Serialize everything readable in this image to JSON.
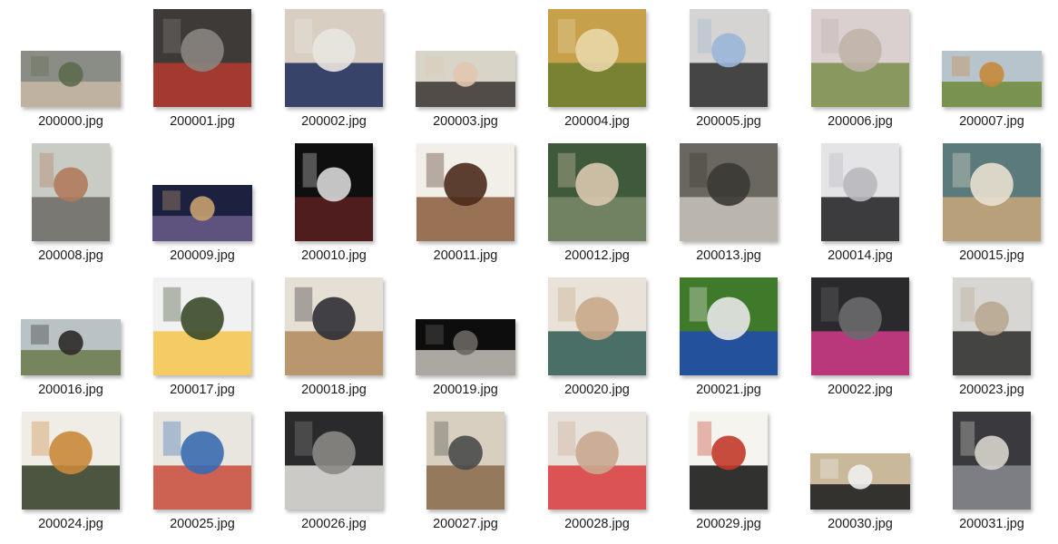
{
  "files": [
    {
      "name": "200000.jpg",
      "icon": "trail-runner-photo-thumbnail",
      "orientation": "landscape",
      "colors": [
        "#8a8d86",
        "#c9b9a4",
        "#5d6a4e"
      ]
    },
    {
      "name": "200001.jpg",
      "icon": "gym-rack-photo-thumbnail",
      "orientation": "square",
      "colors": [
        "#3d3a38",
        "#b53a2e",
        "#8a8580"
      ]
    },
    {
      "name": "200002.jpg",
      "icon": "cap-selfie-photo-thumbnail",
      "orientation": "square",
      "colors": [
        "#d8cfc2",
        "#1c2a5a",
        "#e9e6e1"
      ]
    },
    {
      "name": "200003.jpg",
      "icon": "cyclist-selfie-photo-thumbnail",
      "orientation": "landscape",
      "colors": [
        "#d8d5c8",
        "#3a3430",
        "#e2c7b0"
      ]
    },
    {
      "name": "200004.jpg",
      "icon": "forest-runner-photo-thumbnail",
      "orientation": "square",
      "colors": [
        "#c7a04a",
        "#6a7c2e",
        "#e8d7a8"
      ]
    },
    {
      "name": "200005.jpg",
      "icon": "locker-mirror-photo-thumbnail",
      "orientation": "portrait",
      "colors": [
        "#d6d4d2",
        "#2b2b2d",
        "#9bb6d8"
      ]
    },
    {
      "name": "200006.jpg",
      "icon": "cherry-blossom-path-photo-thumbnail",
      "orientation": "square",
      "colors": [
        "#d9d0cf",
        "#7a8e4a",
        "#bfb3a8"
      ]
    },
    {
      "name": "200007.jpg",
      "icon": "autumn-park-photo-thumbnail",
      "orientation": "landscape",
      "colors": [
        "#b8c4cc",
        "#6e8a3a",
        "#c58a3a"
      ]
    },
    {
      "name": "200008.jpg",
      "icon": "shower-mirror-photo-thumbnail",
      "orientation": "portrait",
      "colors": [
        "#c9cbc5",
        "#6c6a64",
        "#b07a5c"
      ]
    },
    {
      "name": "200009.jpg",
      "icon": "night-crowd-photo-thumbnail",
      "orientation": "landscape",
      "colors": [
        "#1c2140",
        "#6a5a8a",
        "#c9a070"
      ]
    },
    {
      "name": "200010.jpg",
      "icon": "phone-screenshot-thumbnail",
      "orientation": "portrait",
      "colors": [
        "#0f0f10",
        "#5a2020",
        "#d8d8d8"
      ]
    },
    {
      "name": "200011.jpg",
      "icon": "chocolate-plate-photo-thumbnail",
      "orientation": "square",
      "colors": [
        "#f2efe9",
        "#8a5a3a",
        "#4a2a1c"
      ]
    },
    {
      "name": "200012.jpg",
      "icon": "hand-bottle-photo-thumbnail",
      "orientation": "square",
      "colors": [
        "#3f5a3a",
        "#7a8a6a",
        "#d9c8b0"
      ]
    },
    {
      "name": "200013.jpg",
      "icon": "gym-pushups-photo-thumbnail",
      "orientation": "square",
      "colors": [
        "#6a6660",
        "#c8c4bc",
        "#3a3834"
      ]
    },
    {
      "name": "200014.jpg",
      "icon": "couple-studio-photo-thumbnail",
      "orientation": "portrait",
      "colors": [
        "#e4e4e6",
        "#1e1e20",
        "#b8b8bc"
      ]
    },
    {
      "name": "200015.jpg",
      "icon": "cafe-interior-photo-thumbnail",
      "orientation": "square",
      "colors": [
        "#5a7a7c",
        "#c9a87a",
        "#e8e0d0"
      ]
    },
    {
      "name": "200016.jpg",
      "icon": "lake-hiker-photo-thumbnail",
      "orientation": "landscape",
      "colors": [
        "#b9c3c6",
        "#6a7a4a",
        "#2e2a28"
      ]
    },
    {
      "name": "200017.jpg",
      "icon": "egg-bowl-photo-thumbnail",
      "orientation": "square",
      "colors": [
        "#f1f1f1",
        "#f6c64a",
        "#3a4a2a"
      ]
    },
    {
      "name": "200018.jpg",
      "icon": "study-room-photo-thumbnail",
      "orientation": "square",
      "colors": [
        "#e6dfd4",
        "#b08a5a",
        "#2f2f35"
      ]
    },
    {
      "name": "200019.jpg",
      "icon": "deadlift-video-thumbnail",
      "orientation": "landscape",
      "colors": [
        "#0d0d0d",
        "#c8c4bc",
        "#6a6660"
      ]
    },
    {
      "name": "200020.jpg",
      "icon": "living-room-photo-thumbnail",
      "orientation": "square",
      "colors": [
        "#e8e2d8",
        "#2e5a52",
        "#c9a88a"
      ]
    },
    {
      "name": "200021.jpg",
      "icon": "soccer-player-photo-thumbnail",
      "orientation": "square",
      "colors": [
        "#3f7a2a",
        "#1f4ab0",
        "#e8e8e8"
      ]
    },
    {
      "name": "200022.jpg",
      "icon": "car-dashboard-photo-thumbnail",
      "orientation": "square",
      "colors": [
        "#2a2a2c",
        "#d23a8a",
        "#6a6a6e"
      ]
    },
    {
      "name": "200023.jpg",
      "icon": "lobby-mirror-photo-thumbnail",
      "orientation": "portrait",
      "colors": [
        "#d8d6d2",
        "#2a2a2a",
        "#b8a890"
      ]
    },
    {
      "name": "200024.jpg",
      "icon": "meal-tray-photo-thumbnail",
      "orientation": "square",
      "colors": [
        "#f0ede6",
        "#2e3a22",
        "#c9883a"
      ]
    },
    {
      "name": "200025.jpg",
      "icon": "climbing-wall-photo-thumbnail",
      "orientation": "square",
      "colors": [
        "#e9e6e0",
        "#c84a3a",
        "#3a6ab0"
      ]
    },
    {
      "name": "200026.jpg",
      "icon": "bench-press-photo-thumbnail",
      "orientation": "square",
      "colors": [
        "#2a2a2c",
        "#e8e6e2",
        "#8a8884"
      ]
    },
    {
      "name": "200027.jpg",
      "icon": "garage-gym-photo-thumbnail",
      "orientation": "portrait",
      "colors": [
        "#d8cfc0",
        "#8a6a4a",
        "#4a4a4a"
      ]
    },
    {
      "name": "200028.jpg",
      "icon": "baby-highchair-photo-thumbnail",
      "orientation": "square",
      "colors": [
        "#e8e2dc",
        "#d83a3a",
        "#c9a890"
      ]
    },
    {
      "name": "200029.jpg",
      "icon": "calligraphy-photo-thumbnail",
      "orientation": "portrait",
      "colors": [
        "#f6f4ef",
        "#0e0e0e",
        "#c23a2a"
      ]
    },
    {
      "name": "200030.jpg",
      "icon": "black-bags-photo-thumbnail",
      "orientation": "landscape",
      "colors": [
        "#c9b89a",
        "#1a1a1c",
        "#f0f0f0"
      ]
    },
    {
      "name": "200031.jpg",
      "icon": "laptop-screen-photo-thumbnail",
      "orientation": "portrait",
      "colors": [
        "#3a3a3e",
        "#8a8a90",
        "#d8d4cc"
      ]
    }
  ]
}
